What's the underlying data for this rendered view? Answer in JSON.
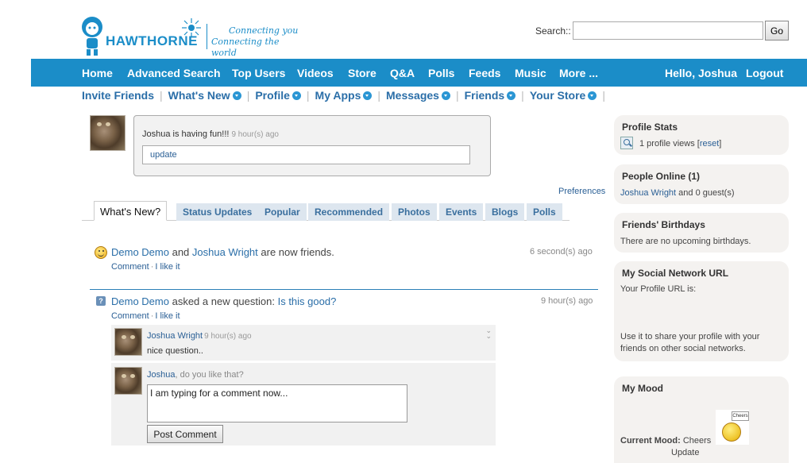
{
  "header": {
    "logo_word": "HAWTHORNE",
    "tagline_1": "Connecting you",
    "tagline_2": "Connecting the world",
    "search_label": "Search::",
    "search_value": "",
    "go_label": "Go"
  },
  "nav": {
    "items": [
      "Home",
      "Advanced Search",
      "Top Users",
      "Videos",
      "Store",
      "Q&A",
      "Polls",
      "Feeds",
      "Music",
      "More ..."
    ],
    "greeting": "Hello, Joshua",
    "logout": "Logout"
  },
  "subnav": {
    "items": [
      "Invite Friends",
      "What's New",
      "Profile",
      "My Apps",
      "Messages",
      "Friends",
      "Your Store"
    ]
  },
  "status": {
    "text": "Joshua is having fun!!!",
    "time": "9 hour(s) ago",
    "input_value": "update"
  },
  "preferences_label": "Preferences",
  "tabs": [
    "What's New?",
    "Status Updates",
    "Popular",
    "Recommended",
    "Photos",
    "Events",
    "Blogs",
    "Polls"
  ],
  "feed": [
    {
      "actor1": "Demo Demo",
      "conj": "and",
      "actor2": "Joshua Wright",
      "text": "are now friends.",
      "time": "6 second(s) ago",
      "comment": "Comment",
      "like": "I like it"
    },
    {
      "actor1": "Demo Demo",
      "text": "asked a new question:",
      "link": "Is this good?",
      "time": "9 hour(s) ago",
      "comment": "Comment",
      "like": "I like it"
    }
  ],
  "comment": {
    "author": "Joshua Wright",
    "time": "9 hour(s) ago",
    "body": "nice question..",
    "prompt_name": "Joshua",
    "prompt_text": ", do you like that?",
    "draft": "I am typing for a comment now...",
    "post_label": "Post Comment"
  },
  "sidebar": {
    "profile_stats": {
      "title": "Profile Stats",
      "views": "1 profile views [",
      "reset": "reset",
      "close": "]"
    },
    "people_online": {
      "title": "People Online (1)",
      "user": "Joshua Wright",
      "rest": "and 0 guest(s)"
    },
    "birthdays": {
      "title": "Friends' Birthdays",
      "text": "There are no upcoming birthdays."
    },
    "social_url": {
      "title": "My Social Network URL",
      "label": "Your Profile URL is:",
      "note": "Use it to share your profile with your friends on other social networks."
    },
    "mood": {
      "title": "My Mood",
      "label": "Current Mood:",
      "value": "Cheers",
      "update": "Update",
      "sign": "Cheers"
    }
  },
  "colors": {
    "brand": "#1b8dc8",
    "link": "#2a5f95"
  }
}
